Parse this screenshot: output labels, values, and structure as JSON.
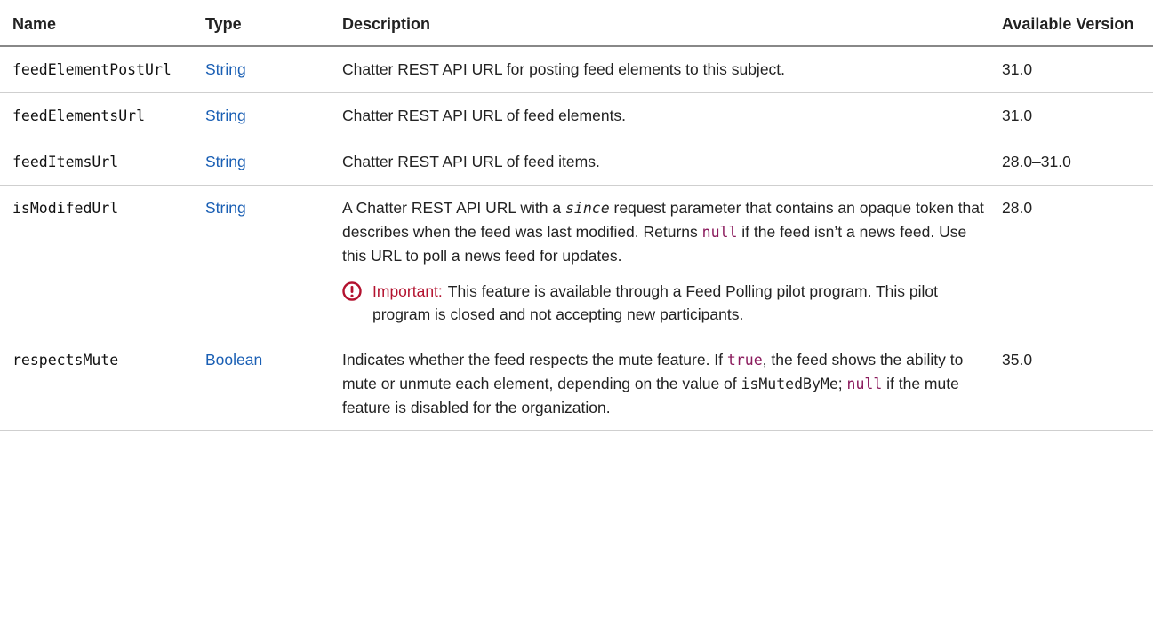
{
  "columns": {
    "name": "Name",
    "type": "Type",
    "description": "Description",
    "version": "Available Version"
  },
  "rows": [
    {
      "name": "feedElementPostUrl",
      "type": "String",
      "description": "Chatter REST API URL for posting feed elements to this subject.",
      "version": "31.0"
    },
    {
      "name": "feedElementsUrl",
      "type": "String",
      "description": "Chatter REST API URL of feed elements.",
      "version": "31.0"
    },
    {
      "name": "feedItemsUrl",
      "type": "String",
      "description": "Chatter REST API URL of feed items.",
      "version": "28.0–31.0"
    },
    {
      "name": "isModifedUrl",
      "type": "String",
      "description_parts": {
        "t1": "A Chatter REST API URL with a ",
        "code1": "since",
        "t2": " request parameter that contains an opaque token that describes when the feed was last modified. Returns ",
        "code2": "null",
        "t3": " if the feed isn’t a news feed. Use this URL to poll a news feed for updates."
      },
      "note": {
        "icon": "important-icon",
        "label": "Important:",
        "text": "This feature is available through a Feed Polling pilot program. This pilot program is closed and not accepting new participants."
      },
      "version": "28.0"
    },
    {
      "name": "respectsMute",
      "type": "Boolean",
      "description_parts": {
        "t1": "Indicates whether the feed respects the mute feature. If ",
        "code1": "true",
        "t2": ", the feed shows the ability to mute or unmute each element, depending on the value of ",
        "code2": "isMutedByMe",
        "t3": "; ",
        "code3": "null",
        "t4": " if the mute feature is disabled for the organization."
      },
      "version": "35.0"
    }
  ],
  "colors": {
    "link": "#1a5fb4",
    "code_keyword": "#8a1a5c",
    "important": "#b3122f"
  }
}
